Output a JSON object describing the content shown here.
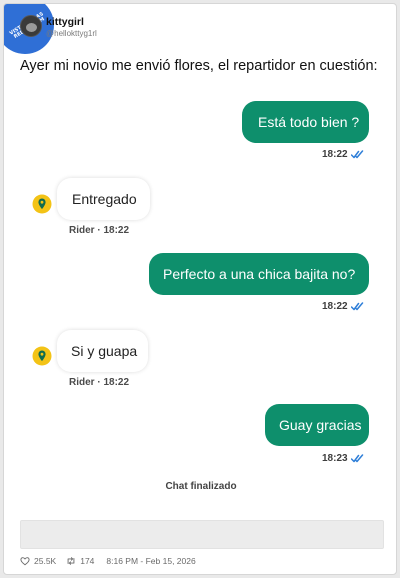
{
  "watermark": {
    "text": "VISTO EN LAS REDES .COM"
  },
  "tweet": {
    "author_name": "kittygirl",
    "author_handle": "@hellokttyg1rl",
    "text": "Ayer mi novio me envió flores, el repartidor en cuestión:"
  },
  "chat": {
    "messages": [
      {
        "text": "Está todo bien ?",
        "time": "18:22"
      },
      {
        "text": "Entregado",
        "meta": "Rider · 18:22"
      },
      {
        "text": "Perfecto a una chica bajita no?",
        "time": "18:22"
      },
      {
        "text": "Si y guapa",
        "meta": "Rider · 18:22"
      },
      {
        "text": "Guay gracias",
        "time": "18:23"
      }
    ],
    "end_label": "Chat finalizado"
  },
  "footer": {
    "likes": "25.5K",
    "retweets": "174",
    "timestamp": "8:16 PM - Feb 15, 2026"
  },
  "colors": {
    "outgoing_bubble": "#0e8f6c",
    "read_checks": "#2f7fd8",
    "rider_pin": "#f3c316",
    "rider_pin_dark": "#0f6b4f"
  }
}
